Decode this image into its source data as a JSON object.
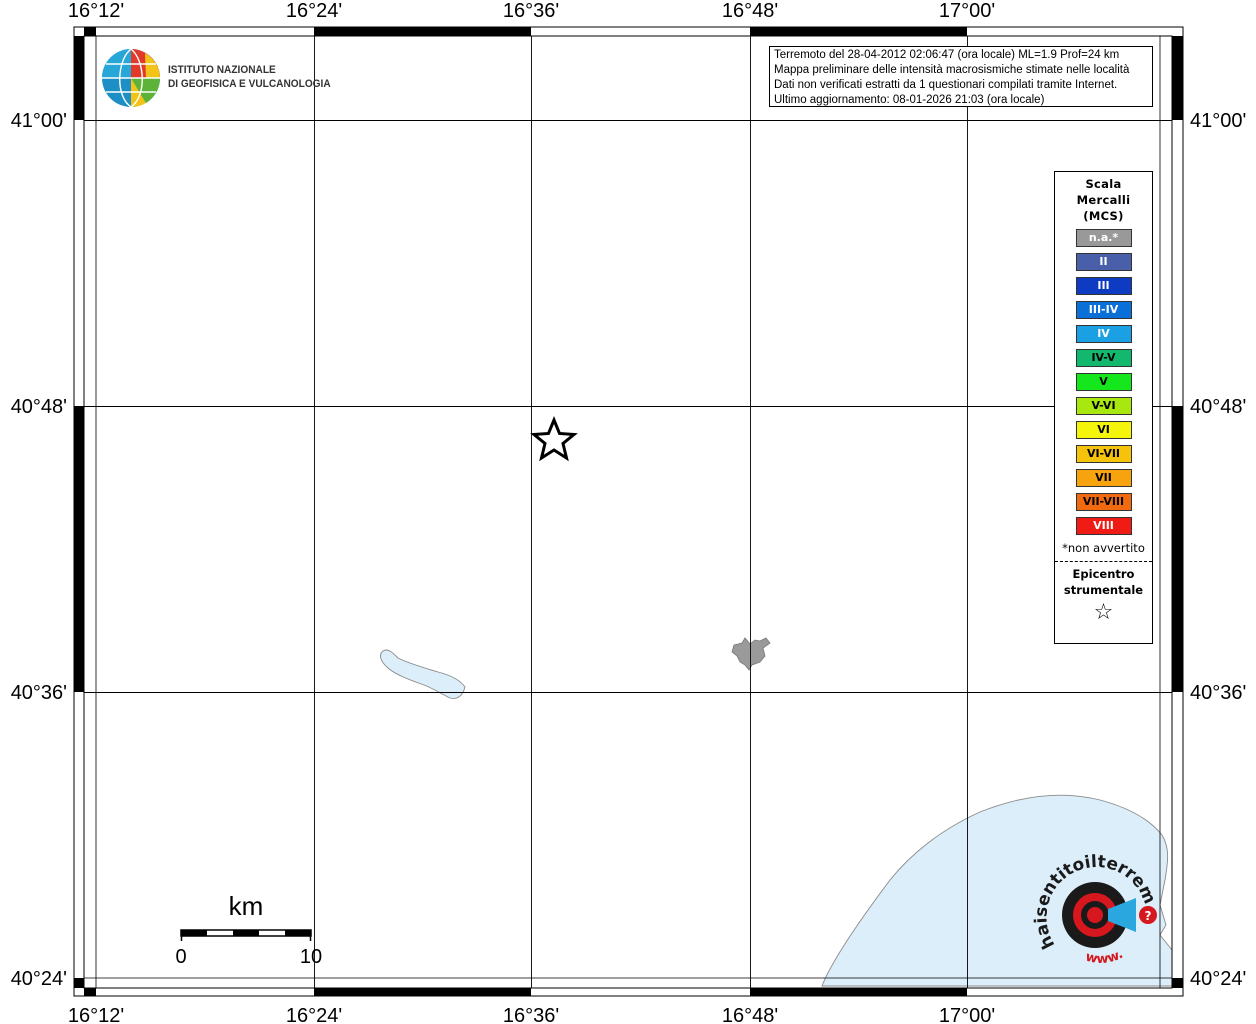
{
  "map": {
    "lon_labels": [
      "16°12'",
      "16°24'",
      "16°36'",
      "16°48'",
      "17°00'"
    ],
    "lat_labels": [
      "41°00'",
      "40°48'",
      "40°36'",
      "40°24'"
    ],
    "land_color": "#ffffff",
    "water_color": "#dbeef9",
    "grid_color": "#000000",
    "epicenter_symbol": "star"
  },
  "institute": {
    "name_line1": "ISTITUTO NAZIONALE",
    "name_line2": "DI GEOFISICA E VULCANOLOGIA",
    "logo_icon": "ingv-globe-logo-icon"
  },
  "info": {
    "line1": "Terremoto del 28-04-2012 02:06:47 (ora locale) ML=1.9 Prof=24 km",
    "line2": "Mappa preliminare delle intensità macrosismiche stimate nelle località",
    "line3": "Dati non verificati estratti da 1 questionari compilati tramite Internet.",
    "line4": "Ultimo aggiornamento: 08-01-2026 21:03 (ora locale)"
  },
  "legend": {
    "title1": "Scala",
    "title2": "Mercalli",
    "title3": "(MCS)",
    "items": [
      {
        "label": "n.a.*",
        "color": "#999999",
        "text": "#ffffff"
      },
      {
        "label": "II",
        "color": "#4a5faa",
        "text": "#ffffff"
      },
      {
        "label": "III",
        "color": "#0d3bc2",
        "text": "#ffffff"
      },
      {
        "label": "III-IV",
        "color": "#0a6fd6",
        "text": "#ffffff"
      },
      {
        "label": "IV",
        "color": "#1ba0e4",
        "text": "#ffffff"
      },
      {
        "label": "IV-V",
        "color": "#11b86e",
        "text": "#000000"
      },
      {
        "label": "V",
        "color": "#14e81c",
        "text": "#000000"
      },
      {
        "label": "V-VI",
        "color": "#a8e80e",
        "text": "#000000"
      },
      {
        "label": "VI",
        "color": "#f5f50c",
        "text": "#000000"
      },
      {
        "label": "VI-VII",
        "color": "#f5c20c",
        "text": "#000000"
      },
      {
        "label": "VII",
        "color": "#f7a30e",
        "text": "#000000"
      },
      {
        "label": "VII-VIII",
        "color": "#f26a10",
        "text": "#000000"
      },
      {
        "label": "VIII",
        "color": "#ef1b14",
        "text": "#ffffff"
      }
    ],
    "note": "*non avvertito",
    "epicentro1": "Epicentro",
    "epicentro2": "strumentale",
    "star_glyph": "☆"
  },
  "scale": {
    "unit": "km",
    "label_start": "0",
    "label_end": "10"
  },
  "hsit": {
    "text": "haisentitoilterremoto.it",
    "url": "www."
  }
}
